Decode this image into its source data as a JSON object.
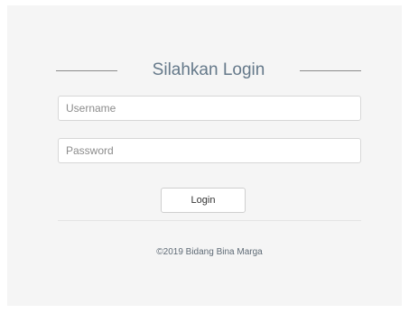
{
  "login": {
    "title": "Silahkan Login",
    "username_placeholder": "Username",
    "password_placeholder": "Password",
    "login_button_label": "Login",
    "footer_text": "©2019 Bidang Bina Marga"
  }
}
